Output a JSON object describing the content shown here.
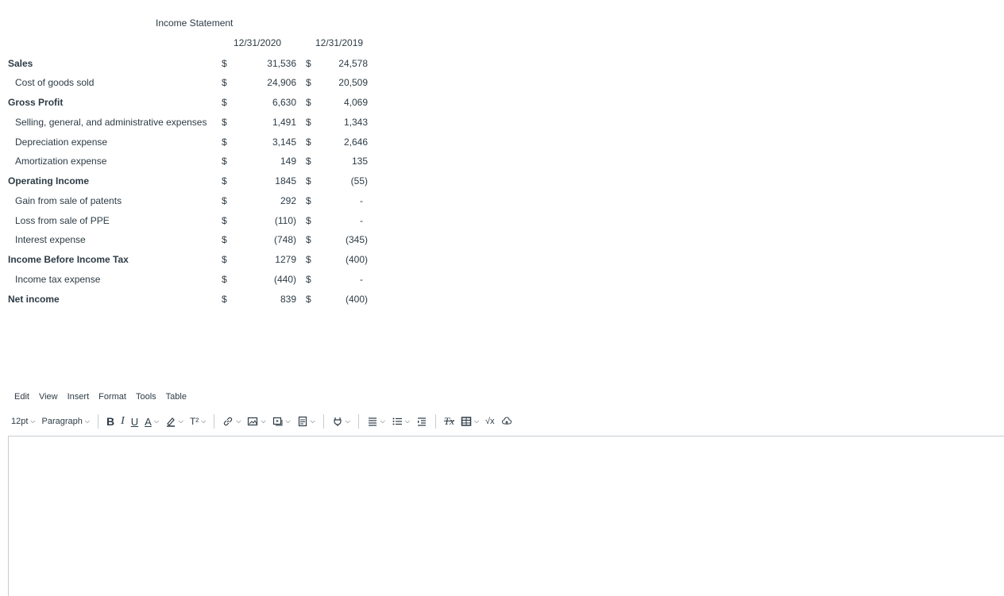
{
  "statement": {
    "title": "Income Statement",
    "col_2020": "12/31/2020",
    "col_2019": "12/31/2019",
    "currency": "$",
    "rows": [
      {
        "label": "Sales",
        "v2020": "31,536",
        "v2019": "24,578"
      },
      {
        "label": "Cost of goods sold",
        "v2020": "24,906",
        "v2019": "20,509"
      },
      {
        "label": "Gross Profit",
        "v2020": "6,630",
        "v2019": "4,069"
      },
      {
        "label": "Selling, general, and administrative expenses",
        "v2020": "1,491",
        "v2019": "1,343"
      },
      {
        "label": "Depreciation expense",
        "v2020": "3,145",
        "v2019": "2,646"
      },
      {
        "label": "Amortization expense",
        "v2020": "149",
        "v2019": "135"
      },
      {
        "label": "Operating Income",
        "v2020": "1845",
        "v2019": "(55)"
      },
      {
        "label": "Gain from sale of patents",
        "v2020": "292",
        "v2019": "-"
      },
      {
        "label": "Loss from sale of PPE",
        "v2020": "(110)",
        "v2019": "-"
      },
      {
        "label": "Interest expense",
        "v2020": "(748)",
        "v2019": "(345)"
      },
      {
        "label": "Income Before Income Tax",
        "v2020": "1279",
        "v2019": "(400)"
      },
      {
        "label": "Income tax expense",
        "v2020": "(440)",
        "v2019": "-"
      },
      {
        "label": "Net income",
        "v2020": "839",
        "v2019": "(400)"
      }
    ]
  },
  "editor": {
    "menu": {
      "edit": "Edit",
      "view": "View",
      "insert": "Insert",
      "format": "Format",
      "tools": "Tools",
      "table": "Table"
    },
    "toolbar": {
      "font_size": "12pt",
      "block_format": "Paragraph",
      "bold": "B",
      "italic": "I",
      "underline": "U",
      "text_color": "A",
      "superscript": "T²",
      "clear_format": "Tx",
      "math": "√x"
    },
    "icons": {
      "link": "link-icon",
      "image": "image-icon",
      "media": "media-icon",
      "document": "document-icon",
      "apps": "plug-icon",
      "align": "align-icon",
      "list": "list-icon",
      "indent": "indent-icon",
      "table": "table-icon",
      "cloud": "cloud-icon"
    }
  }
}
